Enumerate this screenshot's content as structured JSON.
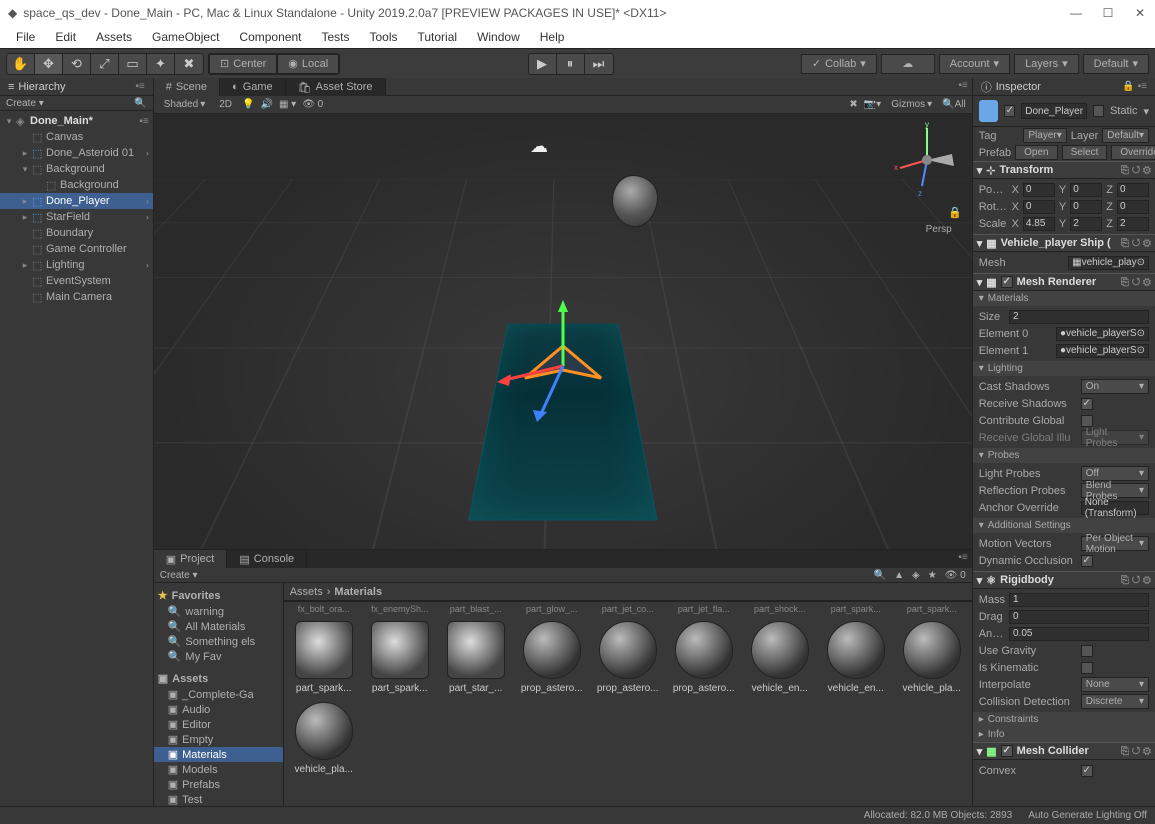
{
  "window": {
    "title": "space_qs_dev - Done_Main - PC, Mac & Linux Standalone - Unity 2019.2.0a7 [PREVIEW PACKAGES IN USE]* <DX11>"
  },
  "menu": [
    "File",
    "Edit",
    "Assets",
    "GameObject",
    "Component",
    "Tests",
    "Tools",
    "Tutorial",
    "Window",
    "Help"
  ],
  "toolbar": {
    "center": "Center",
    "local": "Local",
    "collab": "Collab",
    "account": "Account",
    "layers": "Layers",
    "layout": "Default"
  },
  "hierarchy": {
    "title": "Hierarchy",
    "create": "Create",
    "scene": "Done_Main*",
    "items": [
      {
        "label": "Canvas",
        "indent": 1,
        "prefab": false
      },
      {
        "label": "Done_Asteroid 01",
        "indent": 1,
        "prefab": true,
        "expand": true
      },
      {
        "label": "Background",
        "indent": 1,
        "prefab": false,
        "expanded": true
      },
      {
        "label": "Background",
        "indent": 2,
        "prefab": false
      },
      {
        "label": "Done_Player",
        "indent": 1,
        "prefab": true,
        "selected": true,
        "expand": true
      },
      {
        "label": "StarField",
        "indent": 1,
        "prefab": true,
        "expand": true
      },
      {
        "label": "Boundary",
        "indent": 1,
        "prefab": false
      },
      {
        "label": "Game Controller",
        "indent": 1,
        "prefab": false
      },
      {
        "label": "Lighting",
        "indent": 1,
        "prefab": false,
        "expand": true
      },
      {
        "label": "EventSystem",
        "indent": 1,
        "prefab": false
      },
      {
        "label": "Main Camera",
        "indent": 1,
        "prefab": false
      }
    ]
  },
  "sceneTabs": {
    "scene": "Scene",
    "game": "Game",
    "store": "Asset Store"
  },
  "sceneToolbar": {
    "shaded": "Shaded",
    "mode2d": "2D",
    "gizmos": "Gizmos",
    "all": "All"
  },
  "scene": {
    "persp": "Persp"
  },
  "project": {
    "title": "Project",
    "console": "Console",
    "create": "Create",
    "zeroCount": "0",
    "favorites": "Favorites",
    "favItems": [
      "warning",
      "All Materials",
      "Something els",
      "My Fav"
    ],
    "assets": "Assets",
    "folders": [
      "_Complete-Ga",
      "Audio",
      "Editor",
      "Empty",
      "Materials",
      "Models",
      "Prefabs",
      "Test"
    ],
    "selectedFolder": "Materials",
    "breadcrumb": [
      "Assets",
      "Materials"
    ],
    "topRow": [
      "fx_bolt_ora...",
      "fx_enemySh...",
      "part_blast_...",
      "part_glow_...",
      "part_jet_co...",
      "part_jet_fla...",
      "part_shock...",
      "part_spark...",
      "part_spark..."
    ],
    "gridItems": [
      "part_spark...",
      "part_spark...",
      "part_star_...",
      "prop_astero...",
      "prop_astero...",
      "prop_astero...",
      "vehicle_en...",
      "vehicle_en...",
      "vehicle_pla...",
      "vehicle_pla..."
    ]
  },
  "inspector": {
    "title": "Inspector",
    "objectName": "Done_Player",
    "static": "Static",
    "tag": "Tag",
    "tagVal": "Player",
    "layer": "Layer",
    "layerVal": "Default",
    "prefab": "Prefab",
    "open": "Open",
    "select": "Select",
    "overrides": "Overrides",
    "transform": {
      "title": "Transform",
      "position": "Position",
      "rotation": "Rotation",
      "scale": "Scale",
      "pos": [
        "0",
        "0",
        "0"
      ],
      "rot": [
        "0",
        "0",
        "0"
      ],
      "scl": [
        "4.85",
        "2",
        "2"
      ]
    },
    "meshFilter": {
      "title": "Vehicle_player Ship (",
      "mesh": "Mesh",
      "meshVal": "vehicle_play"
    },
    "meshRenderer": {
      "title": "Mesh Renderer",
      "materials": "Materials",
      "size": "Size",
      "sizeVal": "2",
      "element0": "Element 0",
      "element1": "Element 1",
      "matVal": "vehicle_playerS",
      "lighting": "Lighting",
      "cast": "Cast Shadows",
      "castVal": "On",
      "recv": "Receive Shadows",
      "contrib": "Contribute Global",
      "recvGlobal": "Receive Global Illu",
      "recvGlobalVal": "Light Probes",
      "probes": "Probes",
      "lightProbes": "Light Probes",
      "lightProbesVal": "Off",
      "reflProbes": "Reflection Probes",
      "reflProbesVal": "Blend Probes",
      "anchor": "Anchor Override",
      "anchorVal": "None (Transform)",
      "addl": "Additional Settings",
      "motion": "Motion Vectors",
      "motionVal": "Per Object Motion",
      "dynOcc": "Dynamic Occlusion"
    },
    "rigidbody": {
      "title": "Rigidbody",
      "mass": "Mass",
      "massVal": "1",
      "drag": "Drag",
      "dragVal": "0",
      "angDrag": "Angular Drag",
      "angDragVal": "0.05",
      "useGrav": "Use Gravity",
      "isKin": "Is Kinematic",
      "interp": "Interpolate",
      "interpVal": "None",
      "collDet": "Collision Detection",
      "collDetVal": "Discrete",
      "constraints": "Constraints",
      "info": "Info"
    },
    "meshCollider": {
      "title": "Mesh Collider",
      "convex": "Convex"
    }
  },
  "statusbar": {
    "allocated": "Allocated: 82.0 MB Objects: 2893",
    "lighting": "Auto Generate Lighting Off"
  }
}
